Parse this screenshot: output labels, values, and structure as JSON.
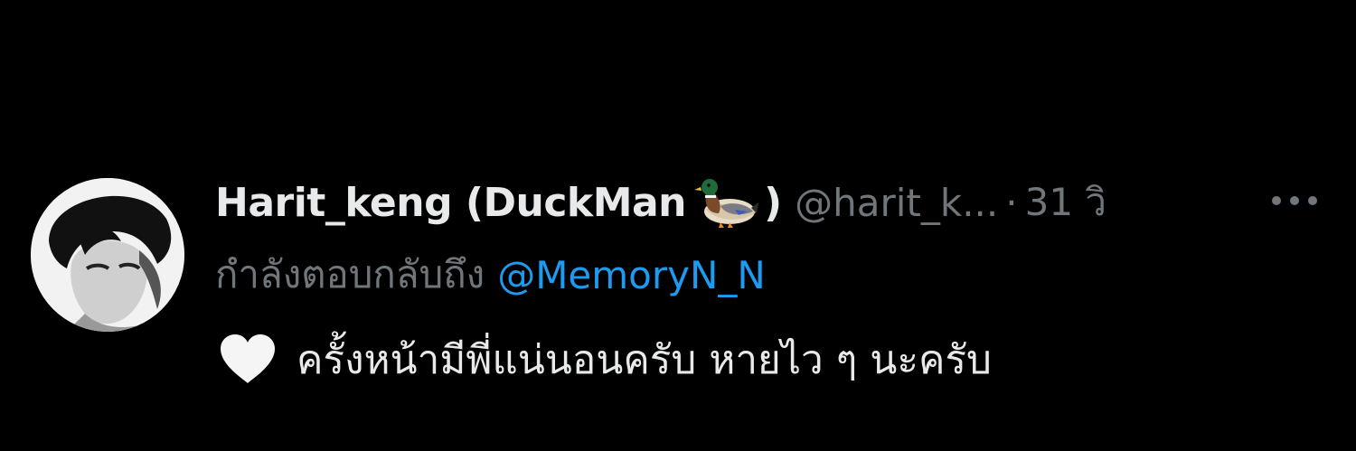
{
  "tweet": {
    "display_name": "Harit_keng (DuckMan",
    "name_suffix_icon": "duck-emoji-icon",
    "name_close": ")",
    "handle": "@harit_k...",
    "separator": "·",
    "time": "31 วิ",
    "more_icon": "more-horizontal-icon",
    "replying_label": "กำลังตอบกลับถึง",
    "replying_to": "@MemoryN_N",
    "leading_icon": "white-heart-icon",
    "text": "ครั้งหน้ามีพี่แน่นอนครับ หายไว ๆ นะครับ"
  },
  "colors": {
    "background": "#000000",
    "primary_text": "#e7e9ea",
    "secondary_text": "#71767b",
    "link": "#1d9bf0"
  }
}
